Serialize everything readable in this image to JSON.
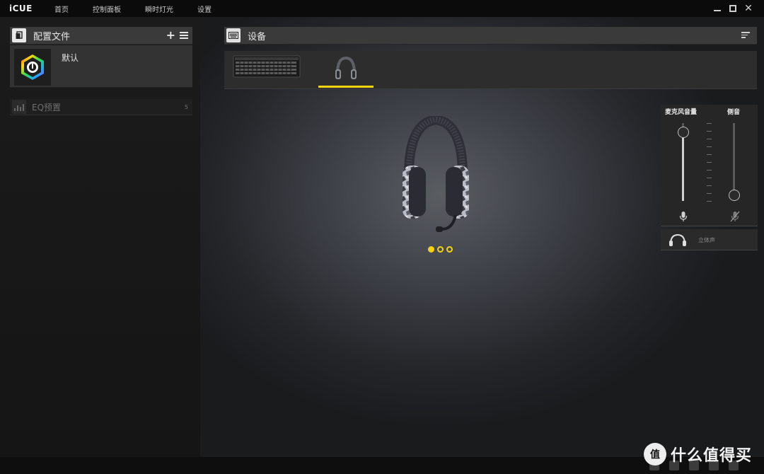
{
  "app": {
    "logo": "iCUE"
  },
  "nav": {
    "items": [
      {
        "label": "首页"
      },
      {
        "label": "控制面板"
      },
      {
        "label": "瞬时灯光"
      },
      {
        "label": "设置"
      }
    ]
  },
  "window_controls": [
    "minimize-icon",
    "maximize-icon",
    "close-icon"
  ],
  "profiles": {
    "header_title": "配置文件",
    "header_icon": "profile-files-icon",
    "add_icon": "plus-icon",
    "menu_icon": "hamburger-menu-icon",
    "current": {
      "name": "默认",
      "icon": "icue-logo-hexagon-icon"
    },
    "eq_presets": {
      "label": "EQ预置",
      "count": "5",
      "icon": "equalizer-icon"
    }
  },
  "devices": {
    "header_title": "设备",
    "header_icon": "keyboard-icon",
    "sort_icon": "sort-lines-icon",
    "tabs": [
      {
        "name": "keyboard",
        "icon": "keyboard-icon",
        "selected": false
      },
      {
        "name": "headset",
        "icon": "headset-icon",
        "selected": true
      }
    ],
    "pager": {
      "pages": 3,
      "active_index": 0
    }
  },
  "audio": {
    "mic_volume_label": "麦克风音量",
    "sidetone_label": "侧音",
    "mic_volume_level": 0.88,
    "sidetone_level": 0.0,
    "mic_icon": "microphone-icon",
    "sidetone_icon": "microphone-muted-icon",
    "stereo_label": "立体声",
    "stereo_icon": "headphones-icon"
  },
  "footer": {
    "social_icons": [
      "forum-icon",
      "chat-icon",
      "twitter-icon",
      "facebook-icon",
      "community-icon"
    ]
  },
  "watermark": {
    "badge_text": "值",
    "text": "什么值得买"
  },
  "colors": {
    "accent": "#f5d40f",
    "panel_header": "#3a3a3a",
    "background": "#121212"
  }
}
